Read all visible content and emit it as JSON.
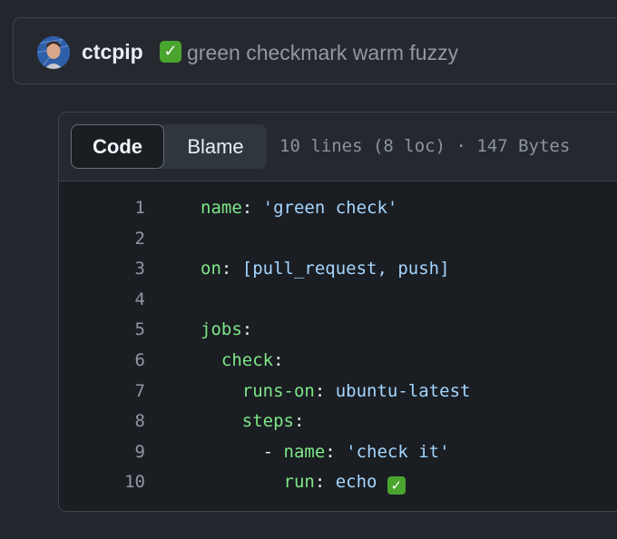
{
  "commit": {
    "author": "ctcpip",
    "message": "green checkmark warm fuzzy"
  },
  "file": {
    "tabs": [
      "Code",
      "Blame"
    ],
    "meta": "10 lines (8 loc) · 147 Bytes"
  },
  "icons": {
    "checkmark": "white-heavy-check-mark-emoji",
    "avatar": "user-avatar"
  },
  "code_lines": [
    {
      "n": "1",
      "indent": "",
      "key": "name",
      "sep": ": ",
      "val": "'green check'"
    },
    {
      "n": "2",
      "indent": "",
      "key": "",
      "sep": "",
      "val": ""
    },
    {
      "n": "3",
      "indent": "",
      "key": "on",
      "sep": ": ",
      "val": "[pull_request, push]"
    },
    {
      "n": "4",
      "indent": "",
      "key": "",
      "sep": "",
      "val": ""
    },
    {
      "n": "5",
      "indent": "",
      "key": "jobs",
      "sep": ":",
      "val": ""
    },
    {
      "n": "6",
      "indent": "  ",
      "key": "check",
      "sep": ":",
      "val": ""
    },
    {
      "n": "7",
      "indent": "    ",
      "key": "runs-on",
      "sep": ": ",
      "val": "ubuntu-latest"
    },
    {
      "n": "8",
      "indent": "    ",
      "key": "steps",
      "sep": ":",
      "val": ""
    },
    {
      "n": "9",
      "indent": "      - ",
      "key": "name",
      "sep": ": ",
      "val": "'check it'"
    },
    {
      "n": "10",
      "indent": "        ",
      "key": "run",
      "sep": ": ",
      "val": "echo "
    }
  ],
  "colors": {
    "yaml_key": "#7ee787",
    "yaml_value": "#a5d6ff",
    "checkmark_bg": "#4aa52e"
  }
}
